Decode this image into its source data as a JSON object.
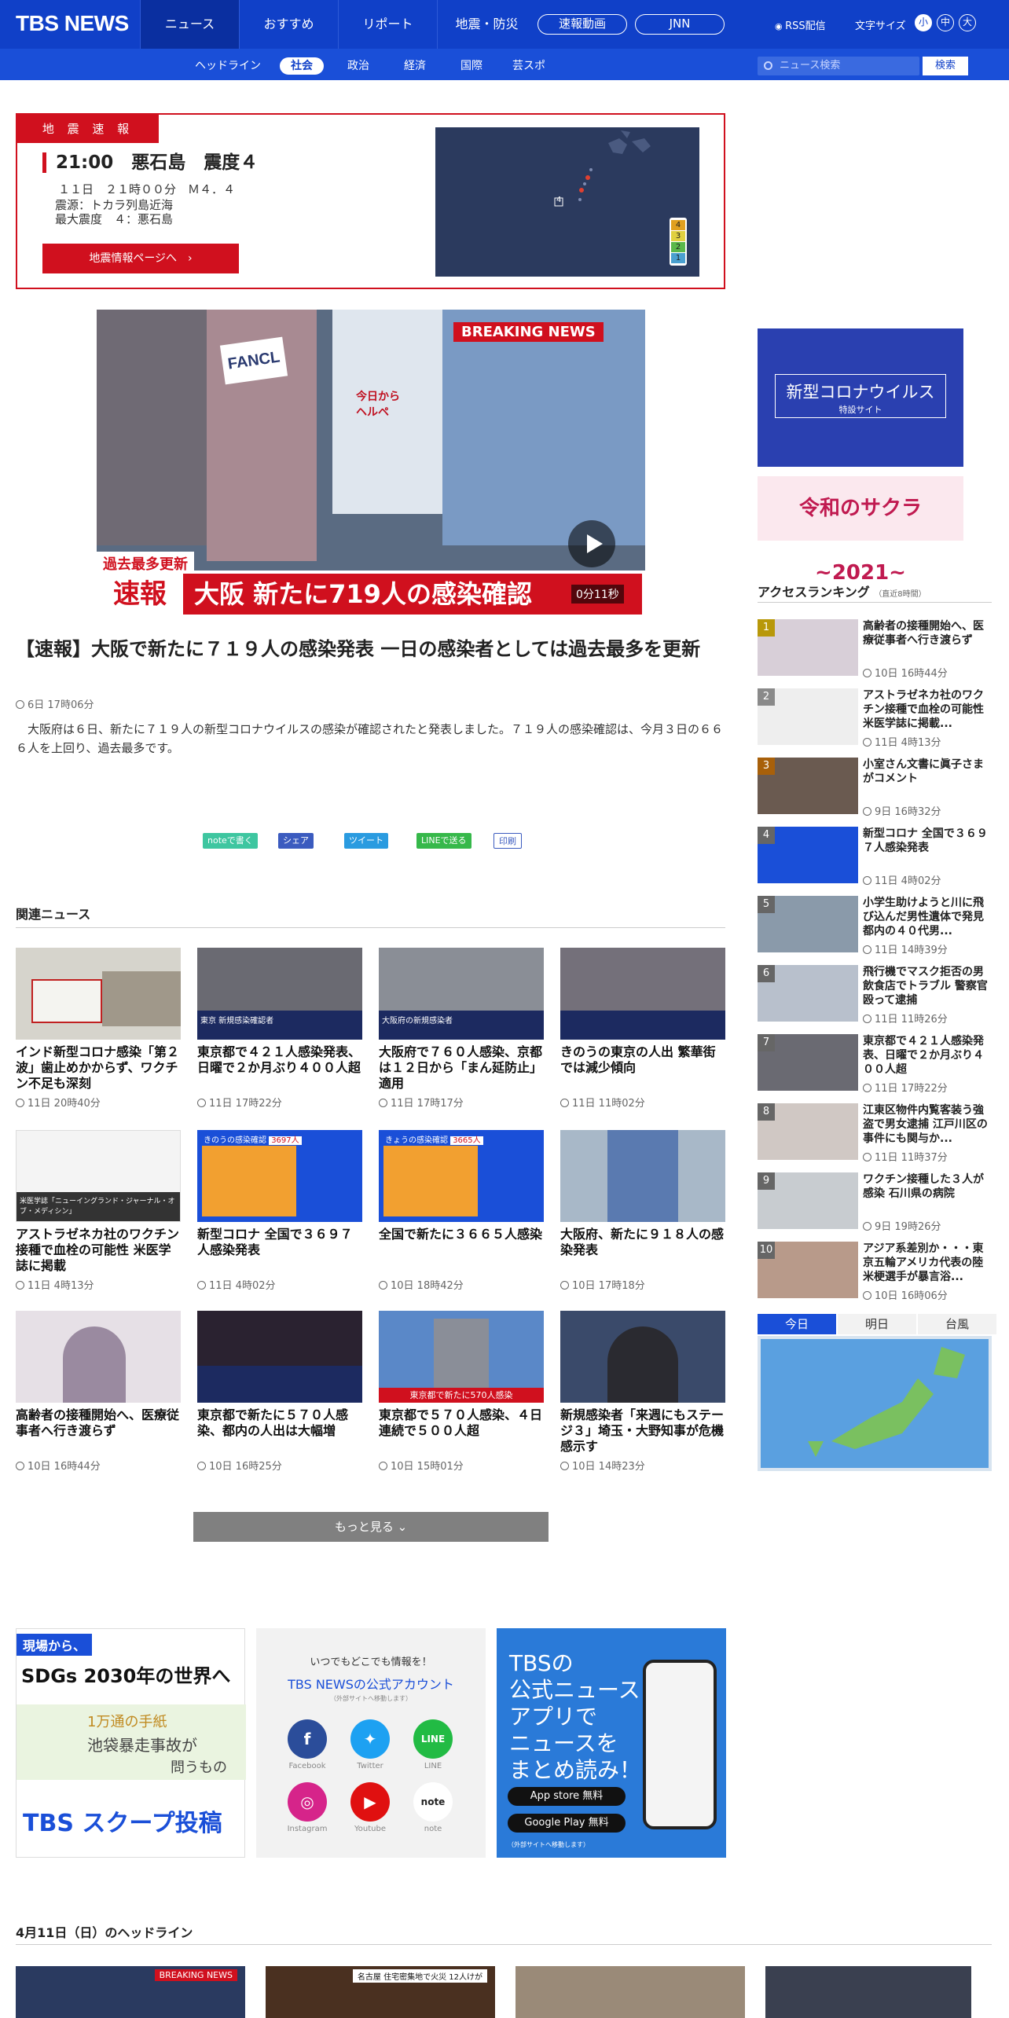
{
  "header": {
    "logo": "TBS NEWS",
    "nav": [
      "ニュース",
      "おすすめ",
      "リポート",
      "地震・防災"
    ],
    "pills": [
      "速報動画",
      "JNN"
    ],
    "rss": "RSS配信",
    "font_size_label": "文字サイズ",
    "sizes": [
      "小",
      "中",
      "大"
    ]
  },
  "subnav": {
    "items": [
      "ヘッドライン",
      "社会",
      "政治",
      "経済",
      "国際",
      "芸スポ"
    ],
    "search_placeholder": "ニュース検索",
    "search_button": "検索"
  },
  "quake": {
    "tag": "地 震 速 報",
    "head": "21:00　悪石島　震度４",
    "lines": [
      "１１日　２１時００分　Ｍ４．４",
      "震源：トカラ列島近海",
      "最大震度　４：悪石島"
    ],
    "button": "地震情報ページへ　›",
    "map_marker": "4",
    "legend": [
      "4",
      "3",
      "2",
      "1"
    ]
  },
  "video": {
    "banner": "BREAKING NEWS",
    "caption_top": "過去最多更新",
    "caption_label": "速報",
    "caption": "大阪 新たに719人の感染確認",
    "duration": "0分11秒",
    "sign1": "FANCL",
    "sign2": "今日から\nヘルペ"
  },
  "article": {
    "title": "【速報】大阪で新たに７１９人の感染発表 一日の感染者としては過去最多を更新",
    "date": "6日 17時06分",
    "body": "　大阪府は６日、新たに７１９人の新型コロナウイルスの感染が確認されたと発表しました。７１９人の感染確認は、今月３日の６６６人を上回り、過去最多です。"
  },
  "share": [
    "noteで書く",
    "シェア",
    "ツイート",
    "LINEで送る",
    "印刷"
  ],
  "related": {
    "title": "関連ニュース",
    "more": "もっと見る",
    "items": [
      {
        "title": "インド新型コロナ感染「第２波」歯止めかからず、ワクチン不足も深刻",
        "date": "11日 20時40分"
      },
      {
        "title": "東京都で４２１人感染発表、日曜で２か月ぶり４００人超",
        "date": "11日 17時22分"
      },
      {
        "title": "大阪府で７６０人感染、京都は１２日から「まん延防止」適用",
        "date": "11日 17時17分"
      },
      {
        "title": "きのうの東京の人出 繁華街では減少傾向",
        "date": "11日 11時02分"
      },
      {
        "title": "アストラゼネカ社のワクチン接種で血栓の可能性 米医学誌に掲載",
        "date": "11日 4時13分"
      },
      {
        "title": "新型コロナ 全国で３６９７人感染発表",
        "date": "11日 4時02分"
      },
      {
        "title": "全国で新たに３６６５人感染",
        "date": "10日 18時42分"
      },
      {
        "title": "大阪府、新たに９１８人の感染発表",
        "date": "10日 17時18分"
      },
      {
        "title": "高齢者の接種開始へ、医療従事者へ行き渡らず",
        "date": "10日 16時44分"
      },
      {
        "title": "東京都で新たに５７０人感染、都内の人出は大幅増",
        "date": "10日 16時25分"
      },
      {
        "title": "東京都で５７０人感染、４日連続で５００人超",
        "date": "10日 15時01分"
      },
      {
        "title": "新規感染者「来週にもステージ３」埼玉・大野知事が危機感示す",
        "date": "10日 14時23分"
      }
    ]
  },
  "thumb_texts": {
    "t2": "東京 新規感染確認者",
    "t3": "大阪府の新規感染者",
    "t5": "米医学誌「ニューイングランド・ジャーナル・オブ・メディシン」",
    "t6": "きのうの感染確認",
    "t6n": "3697人",
    "t7": "きょうの感染確認",
    "t7n": "3665人",
    "t11": "東京都で新たに570人感染"
  },
  "sidebar": {
    "corona_title": "新型コロナウイルス",
    "corona_sub": "特設サイト",
    "sakura": "令和のサクラ~2021~",
    "ranking_title": "アクセスランキング",
    "ranking_sub": "（直近8時間）",
    "ranking": [
      {
        "n": "1",
        "title": "高齢者の接種開始へ、医療従事者へ行き渡らず",
        "date": "10日 16時44分"
      },
      {
        "n": "2",
        "title": "アストラゼネカ社のワクチン接種で血栓の可能性 米医学誌に掲載...",
        "date": "11日 4時13分"
      },
      {
        "n": "3",
        "title": "小室さん文書に眞子さまがコメント",
        "date": "9日 16時32分"
      },
      {
        "n": "4",
        "title": "新型コロナ 全国で３６９７人感染発表",
        "date": "11日 4時02分"
      },
      {
        "n": "5",
        "title": "小学生助けようと川に飛び込んだ男性遺体で発見 都内の４０代男...",
        "date": "11日 14時39分"
      },
      {
        "n": "6",
        "title": "飛行機でマスク拒否の男 飲食店でトラブル 警察官殴って逮捕",
        "date": "11日 11時26分"
      },
      {
        "n": "7",
        "title": "東京都で４２１人感染発表、日曜で２か月ぶり４００人超",
        "date": "11日 17時22分"
      },
      {
        "n": "8",
        "title": "江東区物件内覧客装う強盗で男女逮捕 江戸川区の事件にも関与か...",
        "date": "11日 11時37分"
      },
      {
        "n": "9",
        "title": "ワクチン接種した３人が感染 石川県の病院",
        "date": "9日 19時26分"
      },
      {
        "n": "10",
        "title": "アジア系差別か・・・東京五輪アメリカ代表の陸米梗選手が暴言浴...",
        "date": "10日 16時06分"
      }
    ],
    "weather_tabs": [
      "今日",
      "明日",
      "台風"
    ]
  },
  "promo": {
    "sdgs_tag": "現場から、",
    "sdgs": "SDGs 2030年の世界へ",
    "letters": "1万通の手紙",
    "letters2": "池袋暴走事故が",
    "letters3": "問うもの",
    "scoop": "TBS スクープ投稿",
    "acc_top": "いつでもどこでも情報を！",
    "acc_title": "TBS NEWSの公式アカウント",
    "acc_note": "（外部サイトへ移動します）",
    "socials": [
      "Facebook",
      "Twitter",
      "LINE",
      "Instagram",
      "Youtube",
      "note"
    ],
    "app_big": "TBSの\n公式ニュース\nアプリで\nニュースを\nまとめ読み！",
    "app_store": "App store 無料",
    "google": "Google Play 無料",
    "app_note": "（外部サイトへ移動します）"
  },
  "headline_section": {
    "title": "4月11日（日）のヘッドライン",
    "thumb_tag": "BREAKING NEWS",
    "thumb2": "名古屋 住宅密集地で火災 12人けが"
  }
}
